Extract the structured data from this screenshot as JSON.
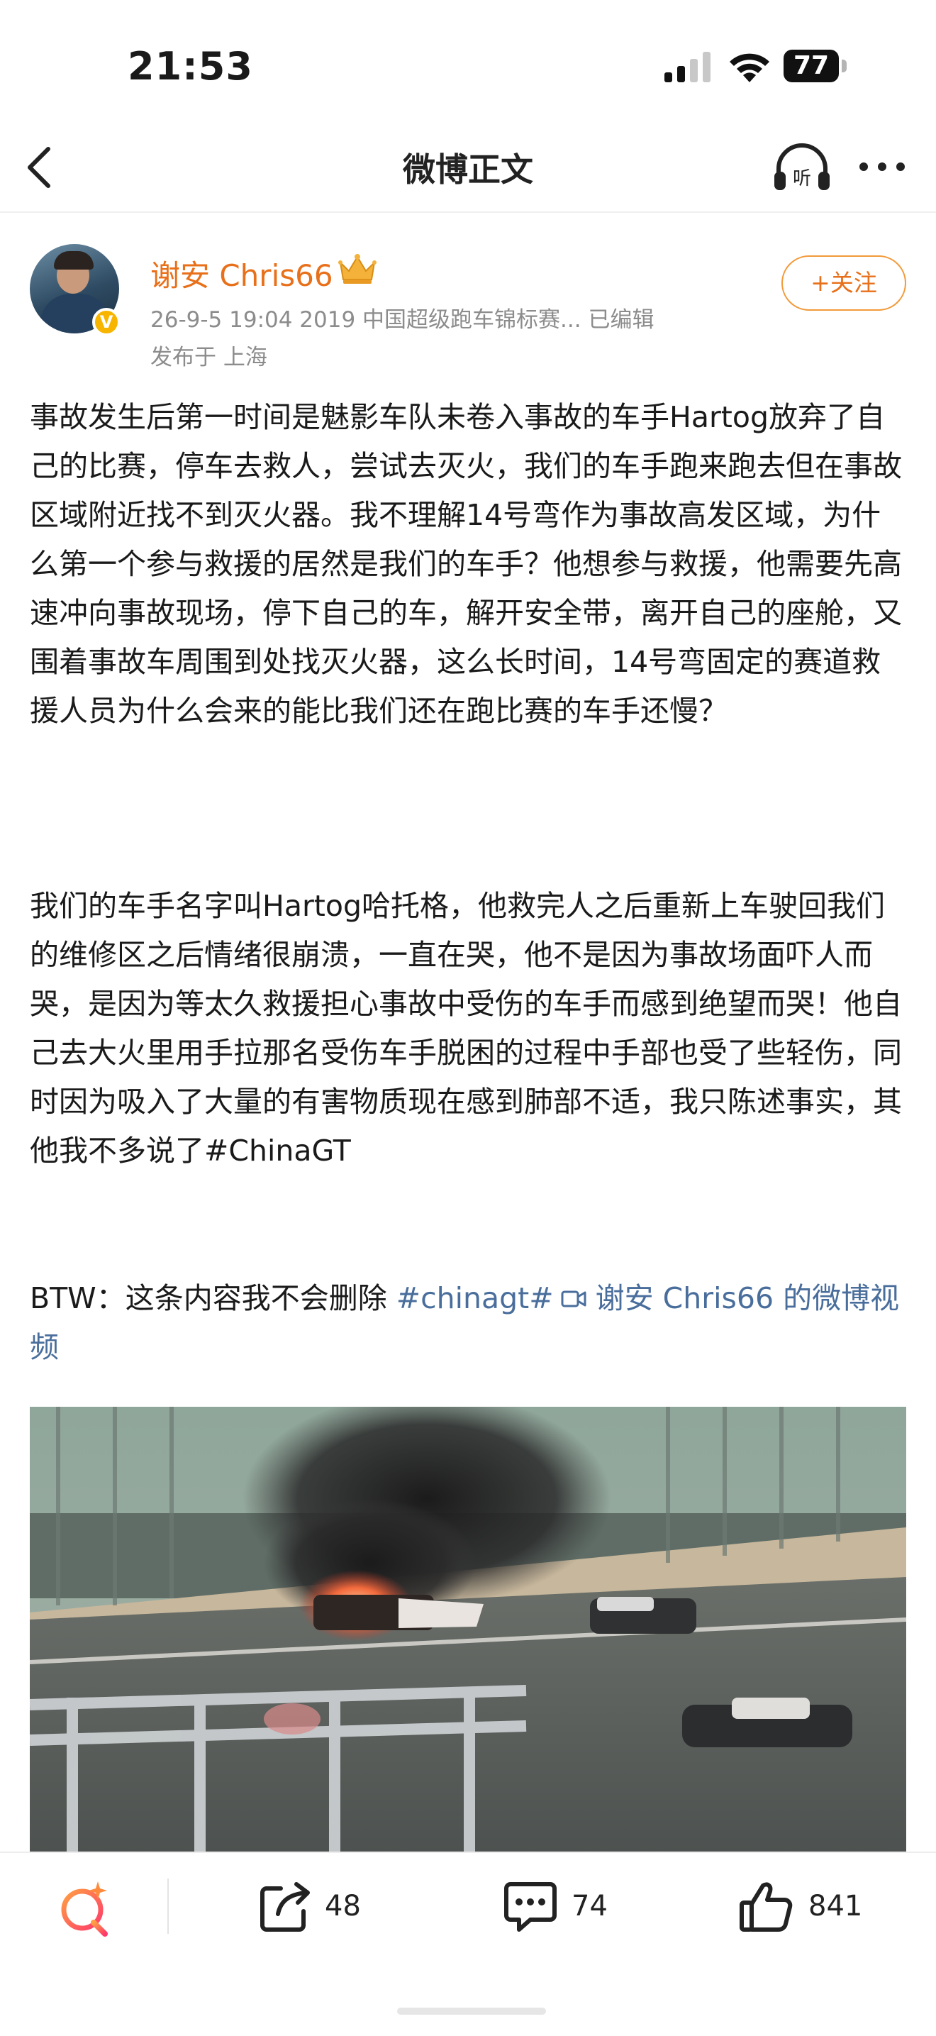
{
  "status_bar": {
    "time": "21:53",
    "battery": "77"
  },
  "nav": {
    "title": "微博正文"
  },
  "author": {
    "name": "谢安 Chris66",
    "badge_icon": "crown-icon",
    "verified_mark": "V",
    "meta": "26-9-5 19:04  2019 中国超级跑车锦标赛...  已编辑",
    "location": "发布于 上海",
    "follow_label": "+关注"
  },
  "post": {
    "paragraph_1": "事故发生后第一时间是魅影车队未卷入事故的车手Hartog放弃了自己的比赛，停车去救人，尝试去灭火，我们的车手跑来跑去但在事故区域附近找不到灭火器。我不理解14号弯作为事故高发区域，为什么第一个参与救援的居然是我们的车手？他想参与救援，他需要先高速冲向事故现场，停下自己的车，解开安全带，离开自己的座舱，又围着事故车周围到处找灭火器，这么长时间，14号弯固定的赛道救援人员为什么会来的能比我们还在跑比赛的车手还慢？",
    "paragraph_2": "我们的车手名字叫Hartog哈托格，他救完人之后重新上车驶回我们的维修区之后情绪很崩溃，一直在哭，他不是因为事故场面吓人而哭，是因为等太久救援担心事故中受伤的车手而感到绝望而哭！他自己去大火里用手拉那名受伤车手脱困的过程中手部也受了些轻伤，同时因为吸入了大量的有害物质现在感到肺部不适，我只陈述事实，其他我不多说了#ChinaGT",
    "paragraph_3_prefix": "BTW：这条内容我不会删除 ",
    "hashtag": "#chinagt#",
    "video_link": " 谢安 Chris66 的微博视频"
  },
  "actions": {
    "repost_count": "48",
    "comment_count": "74",
    "like_count": "841"
  },
  "colors": {
    "accent": "#e8701a",
    "link": "#4a6e9c",
    "meta": "#8c8c8c"
  }
}
